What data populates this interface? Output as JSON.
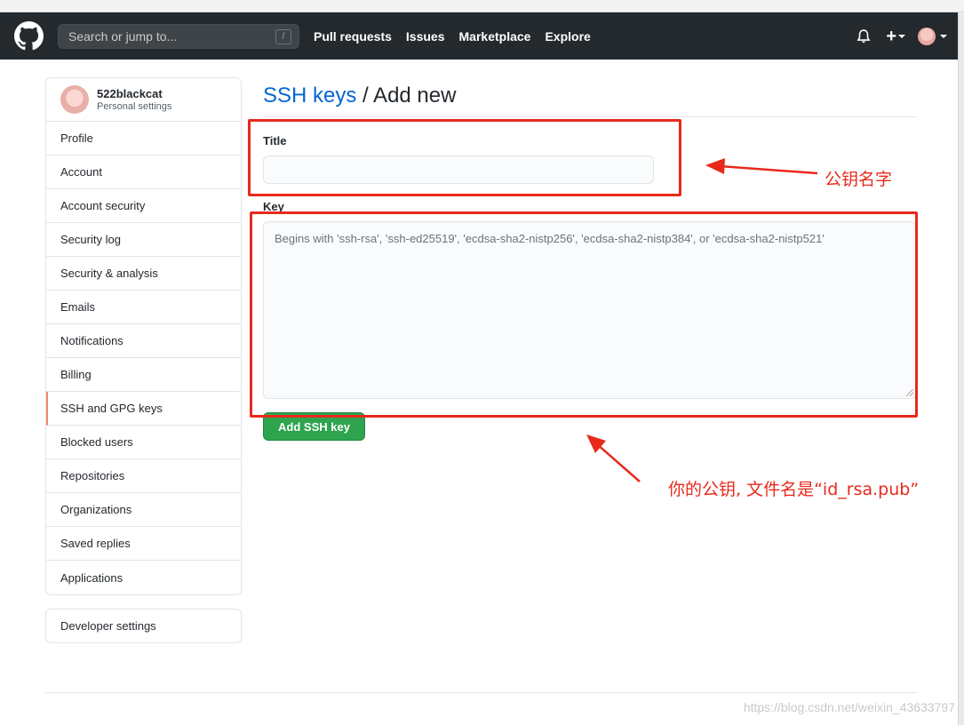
{
  "header": {
    "search_placeholder": "Search or jump to...",
    "search_shortcut": "/",
    "nav": [
      "Pull requests",
      "Issues",
      "Marketplace",
      "Explore"
    ],
    "colors": {
      "background": "#24292e"
    }
  },
  "sidebar": {
    "username": "522blackcat",
    "subtitle": "Personal settings",
    "items": [
      {
        "label": "Profile"
      },
      {
        "label": "Account"
      },
      {
        "label": "Account security"
      },
      {
        "label": "Security log"
      },
      {
        "label": "Security & analysis"
      },
      {
        "label": "Emails"
      },
      {
        "label": "Notifications"
      },
      {
        "label": "Billing"
      },
      {
        "label": "SSH and GPG keys",
        "selected": true
      },
      {
        "label": "Blocked users"
      },
      {
        "label": "Repositories"
      },
      {
        "label": "Organizations"
      },
      {
        "label": "Saved replies"
      },
      {
        "label": "Applications"
      }
    ],
    "developer_settings": "Developer settings"
  },
  "page": {
    "breadcrumb_link": "SSH keys",
    "breadcrumb_rest": " / Add new",
    "title_label": "Title",
    "title_value": "",
    "key_label": "Key",
    "key_placeholder": "Begins with 'ssh-rsa', 'ssh-ed25519', 'ecdsa-sha2-nistp256', 'ecdsa-sha2-nistp384', or 'ecdsa-sha2-nistp521'",
    "submit_label": "Add SSH key"
  },
  "annotations": {
    "title_note": "公钥名字",
    "key_note": "你的公钥, 文件名是“id_rsa.pub”",
    "color": "#e8291c"
  },
  "watermark": "https://blog.csdn.net/weixin_43633797"
}
